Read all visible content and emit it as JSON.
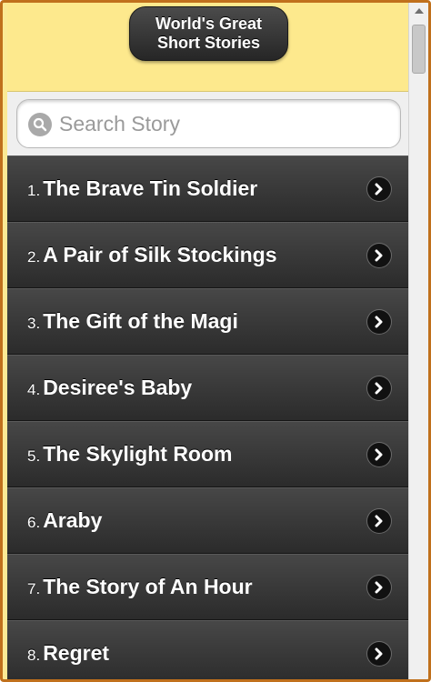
{
  "header": {
    "title_line1": "World's Great",
    "title_line2": "Short Stories"
  },
  "search": {
    "placeholder": "Search Story",
    "value": ""
  },
  "stories": [
    {
      "num": "1.",
      "title": "The Brave Tin Soldier"
    },
    {
      "num": "2.",
      "title": "A Pair of Silk Stockings"
    },
    {
      "num": "3.",
      "title": "The Gift of the Magi"
    },
    {
      "num": "4.",
      "title": "Desiree's Baby"
    },
    {
      "num": "5.",
      "title": "The Skylight Room"
    },
    {
      "num": "6.",
      "title": "Araby"
    },
    {
      "num": "7.",
      "title": "The Story of An Hour"
    },
    {
      "num": "8.",
      "title": "Regret"
    }
  ],
  "icons": {
    "search": "search-icon",
    "list_arrow": "chevron-right-icon"
  },
  "colors": {
    "header_bg": "#fde98d",
    "list_bg": "#333333",
    "frame_border": "#c0701c"
  }
}
